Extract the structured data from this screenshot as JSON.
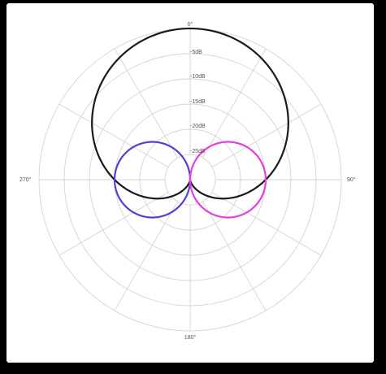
{
  "chart_data": {
    "type": "line",
    "title": "",
    "angle_labels": [
      "0°",
      "90°",
      "180°",
      "270°"
    ],
    "radial_labels": [
      "-5dB",
      "-10dB",
      "-15dB",
      "-20dB",
      "-25dB"
    ],
    "radial_range_db": [
      -30,
      0
    ],
    "grid": true,
    "spoke_step_deg": 30,
    "ring_count": 6,
    "series": [
      {
        "color": "#1a1a1a",
        "pattern": "cardioid",
        "a": 0.5,
        "b": 0.5,
        "gain": 1.0,
        "rotate_deg": 0
      },
      {
        "color": "#5b3bd6",
        "pattern": "figure-8-lobe",
        "a": 0.0,
        "b": 1.0,
        "gain": 0.5,
        "rotate_deg": 270
      },
      {
        "color": "#e83ee0",
        "pattern": "figure-8-lobe",
        "a": 0.0,
        "b": 1.0,
        "gain": 0.5,
        "rotate_deg": 90
      }
    ]
  }
}
